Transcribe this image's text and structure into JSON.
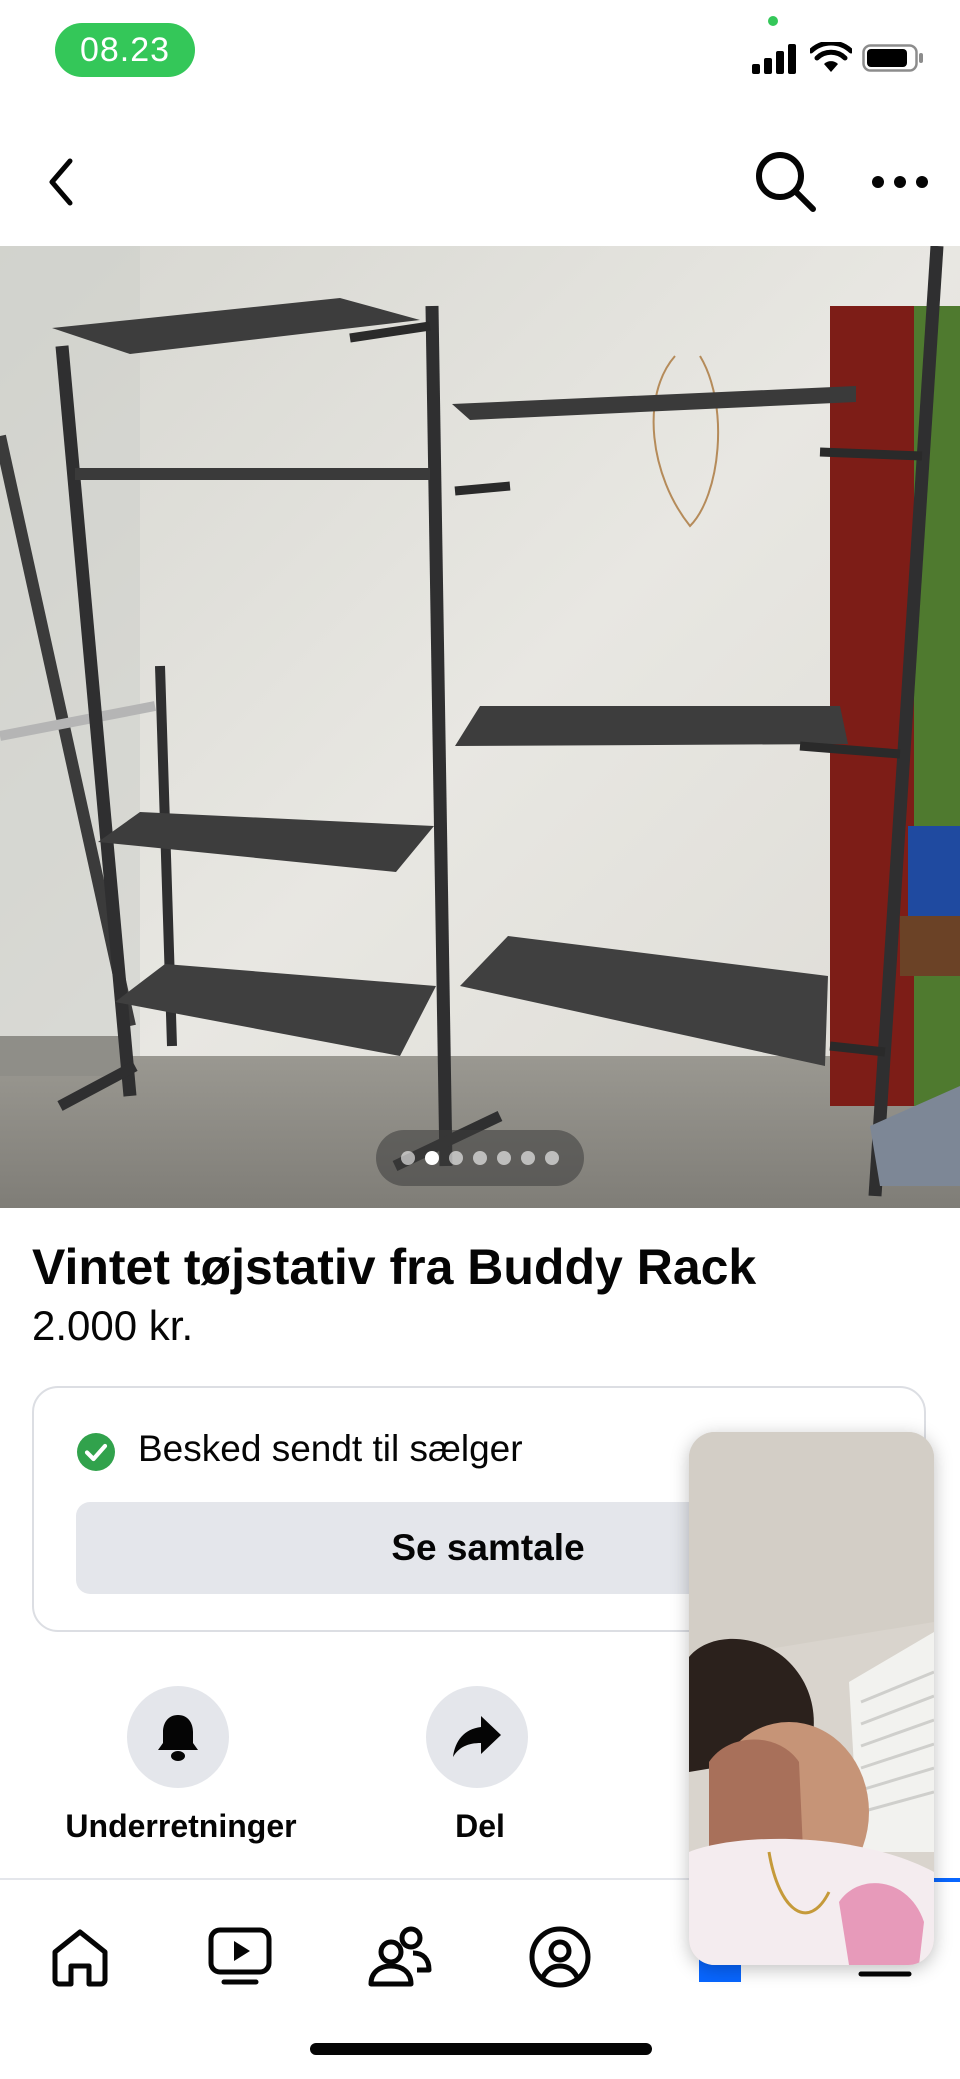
{
  "status_bar": {
    "time": "08.23",
    "colors": {
      "time_pill": "#34c759"
    }
  },
  "icons": {
    "back": "chevron-left-icon",
    "search": "search-icon",
    "more": "more-horizontal-icon"
  },
  "photo": {
    "current_page": 2,
    "total_pages": 7
  },
  "listing": {
    "title": "Vintet tøjstativ fra Buddy Rack",
    "price": "2.000 kr."
  },
  "message_card": {
    "status_text": "Besked sendt til sælger",
    "button_label": "Se samtale",
    "check_color": "#31a24c"
  },
  "actions": [
    {
      "label": "Underretninger",
      "icon": "bell-icon"
    },
    {
      "label": "Del",
      "icon": "share-arrow-icon"
    }
  ],
  "bottom_nav": {
    "items": [
      "home-icon",
      "video-icon",
      "friends-icon",
      "profile-icon",
      "marketplace-icon"
    ],
    "active_index": 4,
    "accent": "#0866ff"
  }
}
